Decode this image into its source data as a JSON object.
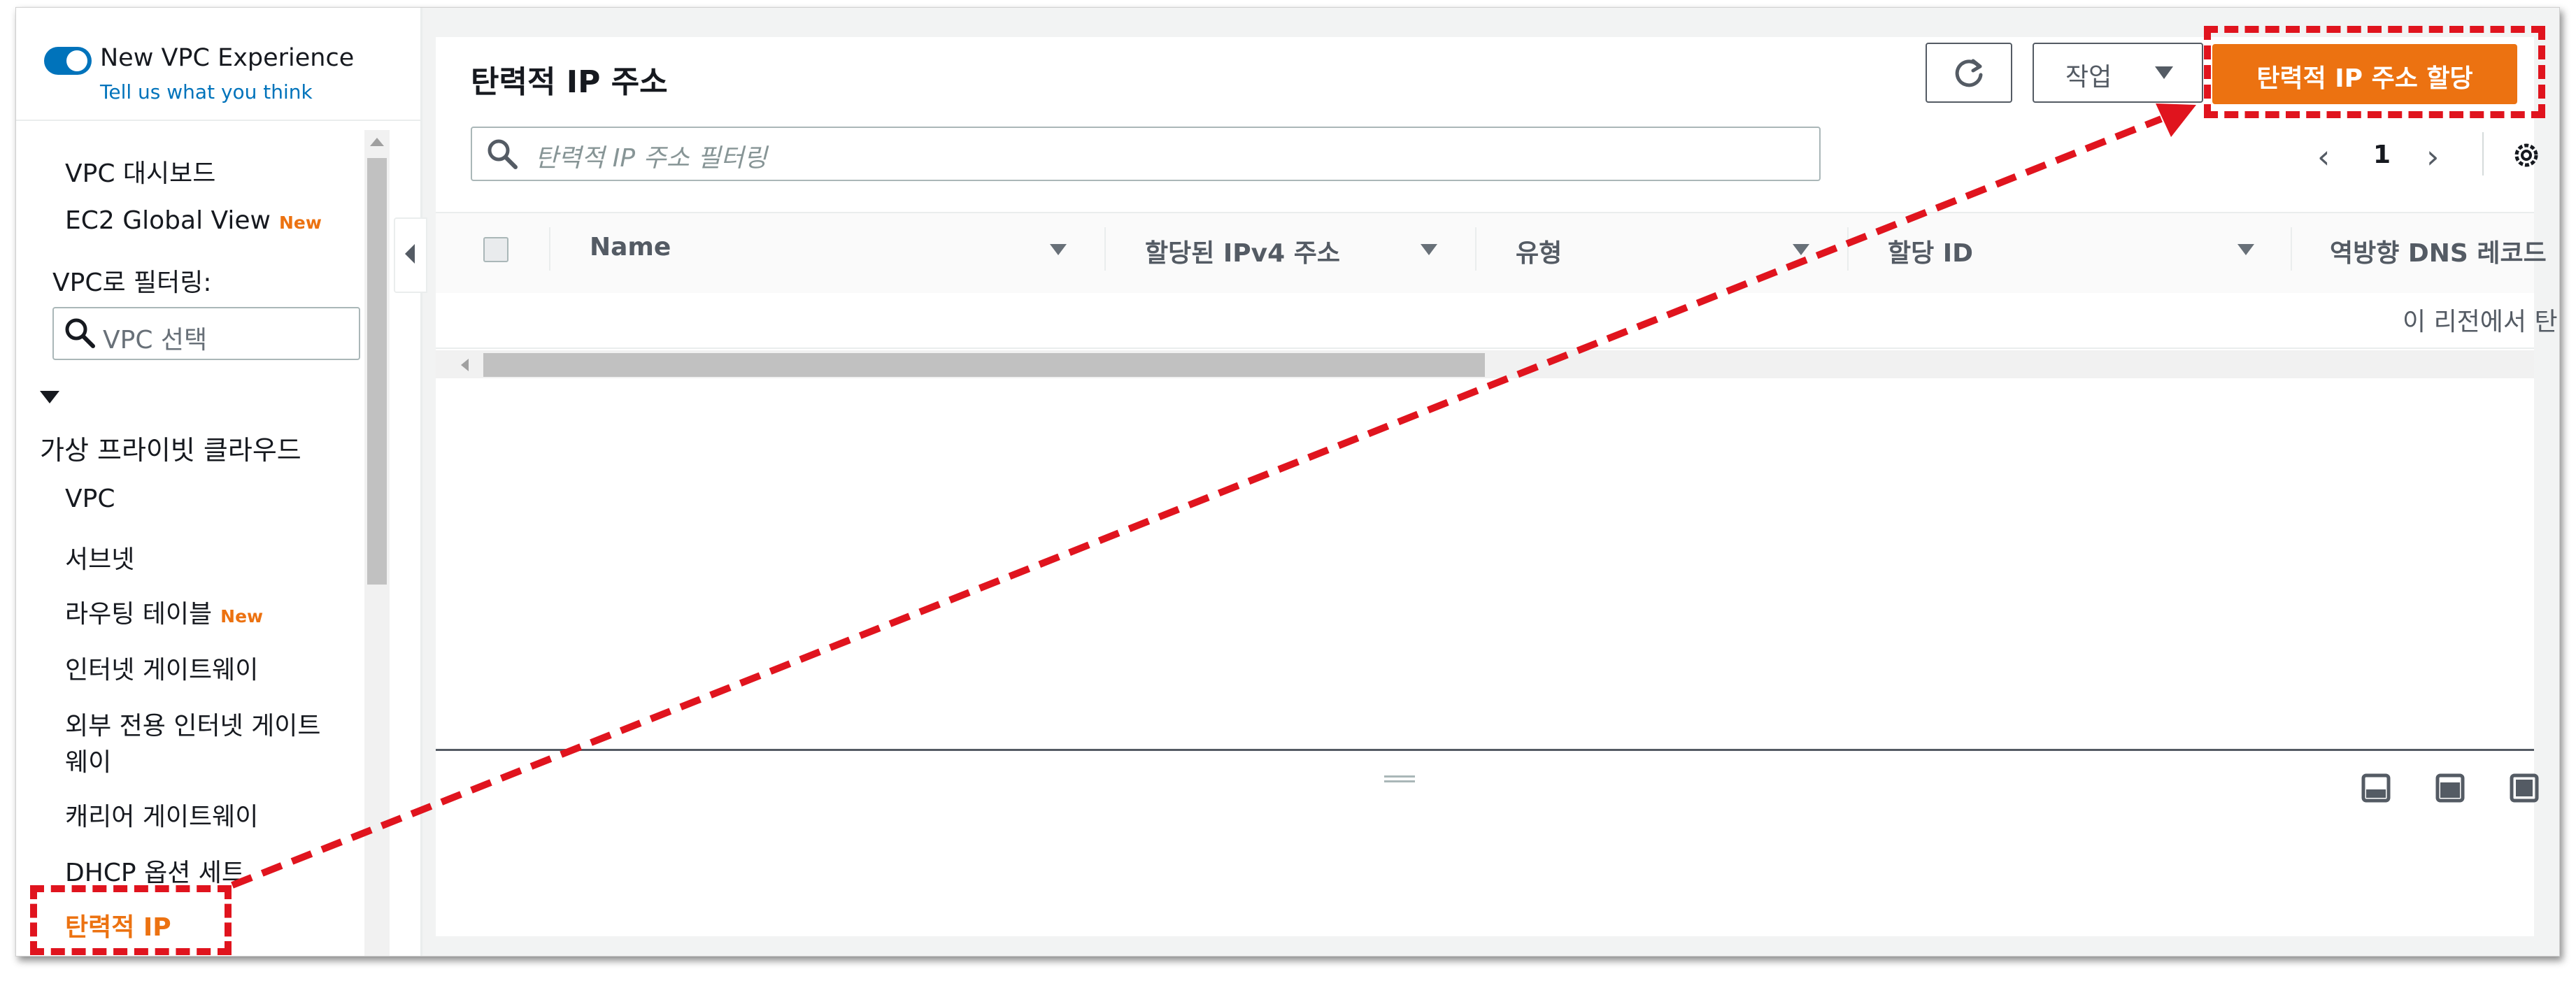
{
  "sidebar": {
    "new_vpc_experience": "New VPC Experience",
    "feedback_link": "Tell us what you think",
    "top_items": [
      {
        "label": "VPC 대시보드",
        "new": ""
      },
      {
        "label": "EC2 Global View",
        "new": "New"
      }
    ],
    "filter_label": "VPC로 필터링:",
    "vpc_select_placeholder": "VPC 선택",
    "section_title": "가상 프라이빗 클라우드",
    "items": [
      {
        "label": "VPC",
        "new": ""
      },
      {
        "label": "서브넷",
        "new": ""
      },
      {
        "label": "라우팅 테이블",
        "new": "New"
      },
      {
        "label": "인터넷 게이트웨이",
        "new": ""
      },
      {
        "label": "외부 전용 인터넷 게이트",
        "new": ""
      },
      {
        "label": "웨이",
        "new": ""
      },
      {
        "label": "캐리어 게이트웨이",
        "new": ""
      },
      {
        "label": "DHCP 옵션 세트",
        "new": ""
      },
      {
        "label": "탄력적 IP",
        "new": ""
      }
    ]
  },
  "main": {
    "title": "탄력적 IP 주소",
    "actions_label": "작업",
    "allocate_label": "탄력적 IP 주소 할당",
    "search_placeholder": "탄력적 IP 주소 필터링",
    "page_number": "1",
    "columns": [
      "Name",
      "할당된 IPv4 주소",
      "유형",
      "할당 ID",
      "역방향 DNS 레코드"
    ],
    "empty_message": "이 리전에서 탄"
  },
  "colors": {
    "accent": "#ec7211",
    "toggle": "#0073bb",
    "highlight": "#e0141e"
  }
}
